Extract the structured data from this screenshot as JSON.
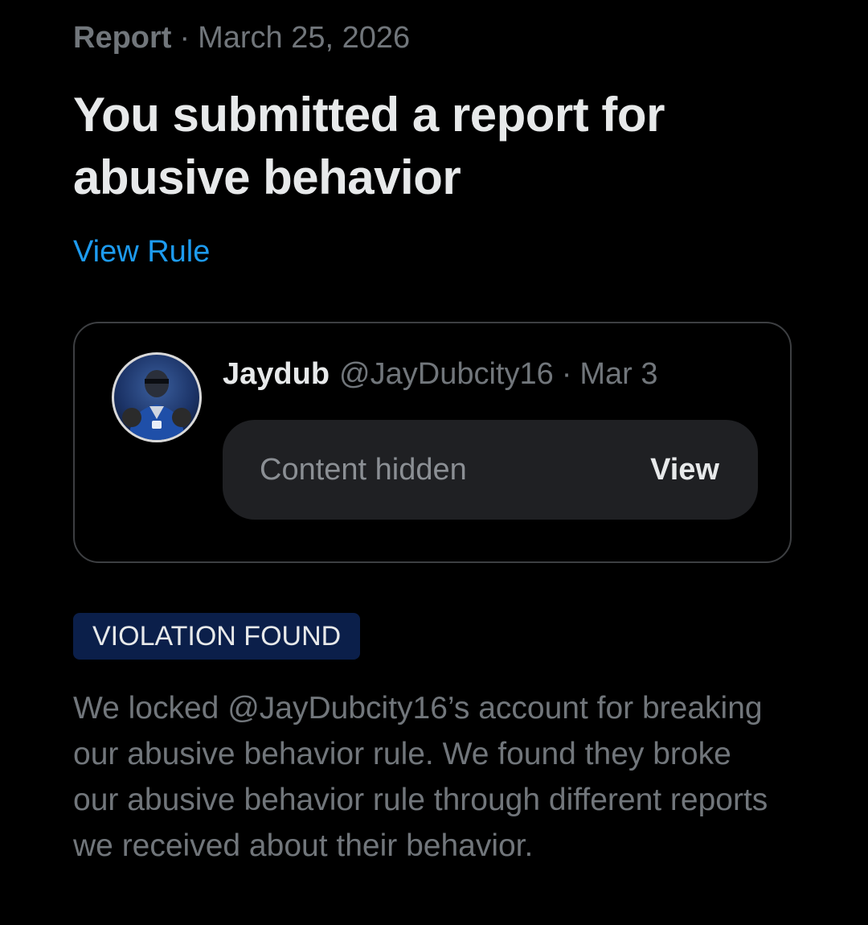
{
  "header": {
    "kind": "Report",
    "separator": "·",
    "date": "March 25, 2026"
  },
  "title": "You submitted a report for abusive behavior",
  "view_rule_label": "View Rule",
  "post": {
    "display_name": "Jaydub",
    "handle": "@JayDubcity16",
    "separator": "·",
    "date": "Mar 3",
    "hidden_label": "Content hidden",
    "view_label": "View"
  },
  "status_badge": "VIOLATION FOUND",
  "message": "We locked @JayDubcity16’s account for breaking our abusive behavior rule. We found they broke our abusive behavior rule through different reports we received about their behavior.",
  "colors": {
    "background": "#000000",
    "primary_text": "#e7e9ea",
    "secondary_text": "#71767b",
    "link": "#1d9bf0",
    "badge_bg": "#0b1f4a",
    "hidden_box_bg": "#1f2023",
    "card_border": "#3d3f42"
  }
}
